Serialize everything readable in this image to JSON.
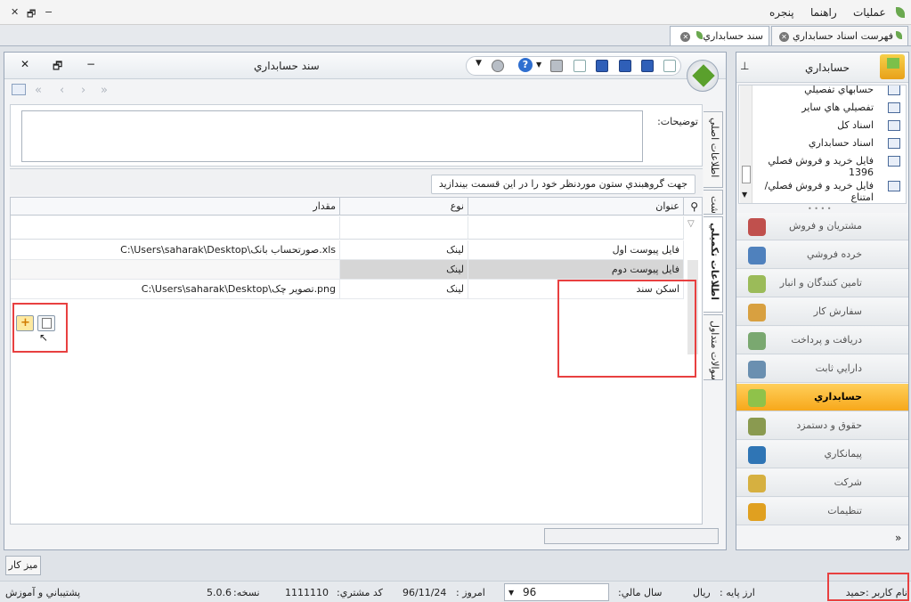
{
  "menu": {
    "operations": "عمليات",
    "help": "راهنما",
    "window": "پنجره"
  },
  "tabs": [
    {
      "label": "فهرست اسناد حسابداري"
    },
    {
      "label": "سند حسابداري"
    }
  ],
  "window": {
    "title": "سند حسابداري"
  },
  "description": {
    "label": "توضيحات:"
  },
  "group_panel": {
    "text": "جهت گروهبندي ستون موردنظر خود را در اين قسمت بيندازيد"
  },
  "grid": {
    "columns": {
      "title": "عنوان",
      "type": "نوع",
      "amount": "مقدار"
    },
    "rows": [
      {
        "title": "فايل پيوست اول",
        "type": "لينک",
        "amount": "C:\\Users\\saharak\\Desktop\\صورتحساب بانک.xls"
      },
      {
        "title": "فايل پيوست دوم",
        "type": "لينک",
        "amount": ""
      },
      {
        "title": "اسکن سند",
        "type": "لينک",
        "amount": "C:\\Users\\saharak\\Desktop\\تصوير چک.png"
      }
    ]
  },
  "vertical_tabs": [
    {
      "label": "اطلاعات اصلي"
    },
    {
      "label": "يادداشت"
    },
    {
      "label": "اطلاعات تکميلي"
    },
    {
      "label": "سوالات متداول"
    }
  ],
  "sidebar": {
    "title": "حسابداري",
    "items": [
      {
        "label": "حسابهاي تفصيلي"
      },
      {
        "label": "تفصيلي هاي ساير"
      },
      {
        "label": "اسناد کل"
      },
      {
        "label": "اسناد حسابداري"
      },
      {
        "label": "فايل خريد و فروش فصلي 1396"
      },
      {
        "label": "فايل خريد و فروش فصلي/امتناع"
      }
    ],
    "modules": [
      {
        "label": "مشتريان و فروش",
        "color": "#c0504d"
      },
      {
        "label": "خرده فروشي",
        "color": "#4f81bd"
      },
      {
        "label": "تامين کنندگان و انبار",
        "color": "#9bbb59"
      },
      {
        "label": "سفارش کار",
        "color": "#d8a040"
      },
      {
        "label": "دريافت و پرداخت",
        "color": "#7aa870"
      },
      {
        "label": "دارايي ثابت",
        "color": "#6a8fb0"
      },
      {
        "label": "حسابداري",
        "color": "#8fc24a"
      },
      {
        "label": "حقوق و دستمزد",
        "color": "#8a9a50"
      },
      {
        "label": "پيمانکاري",
        "color": "#2f75b5"
      },
      {
        "label": "شرکت",
        "color": "#d6b040"
      },
      {
        "label": "تنظيمات",
        "color": "#e0a020"
      }
    ]
  },
  "desk_button": "ميز کار",
  "status": {
    "user": "نام کاربر :حميد",
    "base_currency_label": "ارز پايه :",
    "base_currency": "ريال",
    "fiscal_year_label": "سال مالي:",
    "fiscal_year": "96",
    "today_label": "امروز :",
    "today": "96/11/24",
    "customer_code_label": "کد مشتري:",
    "customer_code": "1111110",
    "version_label": "نسخه:",
    "version": "5.0.6",
    "support": "پشتيباني و آموزش"
  }
}
